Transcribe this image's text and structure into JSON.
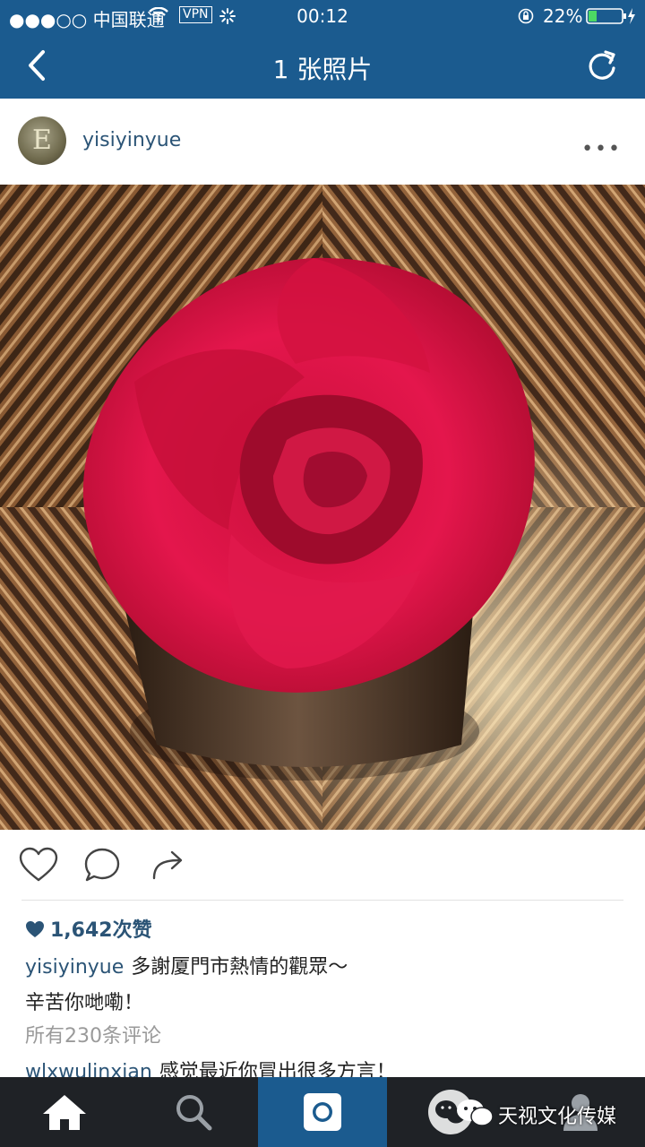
{
  "status_bar": {
    "carrier": "●●●○○ 中国联通",
    "vpn": "VPN",
    "time": "00:12",
    "battery": "22%"
  },
  "nav": {
    "title": "1 张照片",
    "back_icon": "chevron-left-icon",
    "refresh_icon": "refresh-icon"
  },
  "post": {
    "avatar_letter": "E",
    "username": "yisiyinyue",
    "more_label": "•••",
    "likes": "1,642次赞",
    "caption_user": "yisiyinyue",
    "caption_line1": "多謝厦門市熱情的觀眾～",
    "caption_line2": "辛苦你哋嘞！",
    "all_comments": "所有230条评论",
    "comment_user": "wlxwulinxian",
    "comment_text": "感觉最近你冒出很多方言！"
  },
  "watermark": {
    "text": "天视文化传媒"
  },
  "colors": {
    "brand": "#1b5b8f",
    "link": "#2b5476",
    "tabbar": "#1f2226"
  }
}
